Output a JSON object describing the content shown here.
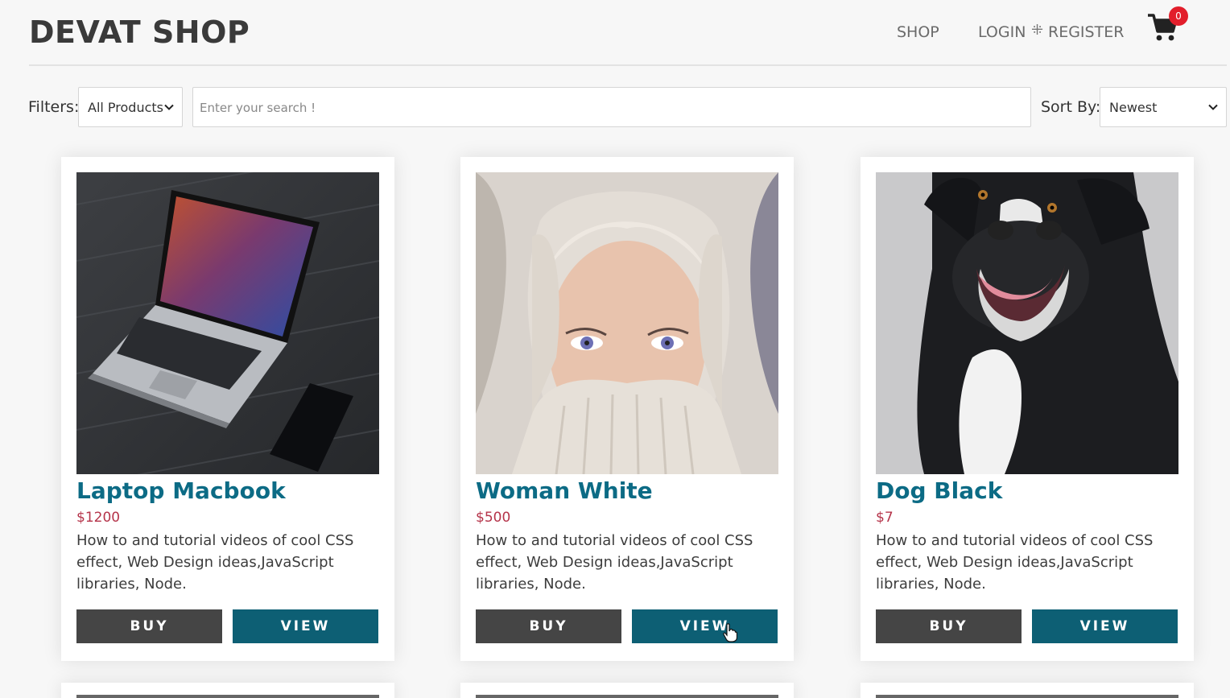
{
  "header": {
    "brand": "DEVAT SHOP",
    "nav": {
      "shop": "SHOP",
      "login": "LOGIN",
      "separator": "⁜",
      "register": "REGISTER"
    },
    "cart": {
      "icon": "shopping-cart-icon",
      "count": "0",
      "badge_color": "#e21e2b"
    }
  },
  "filters": {
    "label": "Filters:",
    "category": "All Products",
    "search_placeholder": "Enter your search !",
    "sort_label": "Sort By:",
    "sort_value": "Newest"
  },
  "colors": {
    "title": "#0c6b85",
    "price": "#b5344a",
    "buy": "#454545",
    "view": "#0d5f74"
  },
  "products": [
    {
      "title": "Laptop Macbook",
      "price": "$1200",
      "description": "How to and tutorial videos of cool CSS effect, Web Design ideas,JavaScript libraries, Node.",
      "buy_label": "BUY",
      "view_label": "VIEW"
    },
    {
      "title": "Woman White",
      "price": "$500",
      "description": "How to and tutorial videos of cool CSS effect, Web Design ideas,JavaScript libraries, Node.",
      "buy_label": "BUY",
      "view_label": "VIEW"
    },
    {
      "title": "Dog Black",
      "price": "$7",
      "description": "How to and tutorial videos of cool CSS effect, Web Design ideas,JavaScript libraries, Node.",
      "buy_label": "BUY",
      "view_label": "VIEW"
    }
  ]
}
